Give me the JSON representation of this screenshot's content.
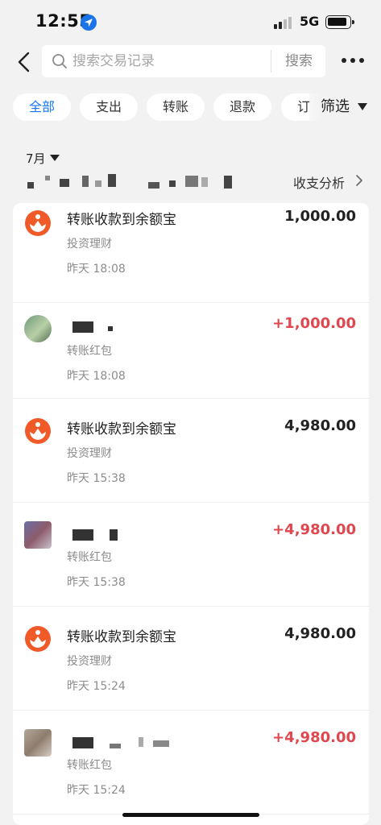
{
  "status_bar": {
    "time": "12:55",
    "network": "5G",
    "icons": [
      "location-arrow-icon",
      "signal-icon",
      "battery-icon"
    ]
  },
  "search": {
    "placeholder": "搜索交易记录",
    "button_label": "搜索"
  },
  "filters": {
    "chips": [
      "全部",
      "支出",
      "转账",
      "退款",
      "订"
    ],
    "active_index": 0,
    "filter_label": "筛选"
  },
  "month": {
    "label": "7月",
    "analysis_label": "收支分析"
  },
  "colors": {
    "accent": "#1677ff",
    "income": "#e0474e",
    "alipay_orange": "#f05a28"
  },
  "transactions": [
    {
      "title": "转账收款到余额宝",
      "category": "投资理财",
      "time": "昨天 18:08",
      "amount": "1,000.00",
      "type": "yuebao",
      "icon": "yuebao-icon"
    },
    {
      "title": "",
      "category": "转账红包",
      "time": "昨天 18:08",
      "amount": "+1,000.00",
      "type": "transfer",
      "icon": "contact-avatar"
    },
    {
      "title": "转账收款到余额宝",
      "category": "投资理财",
      "time": "昨天 15:38",
      "amount": "4,980.00",
      "type": "yuebao",
      "icon": "yuebao-icon"
    },
    {
      "title": "",
      "category": "转账红包",
      "time": "昨天 15:38",
      "amount": "+4,980.00",
      "type": "transfer",
      "icon": "contact-avatar"
    },
    {
      "title": "转账收款到余额宝",
      "category": "投资理财",
      "time": "昨天 15:24",
      "amount": "4,980.00",
      "type": "yuebao",
      "icon": "yuebao-icon"
    },
    {
      "title": "",
      "category": "转账红包",
      "time": "昨天 15:24",
      "amount": "+4,980.00",
      "type": "transfer",
      "icon": "contact-avatar"
    }
  ]
}
